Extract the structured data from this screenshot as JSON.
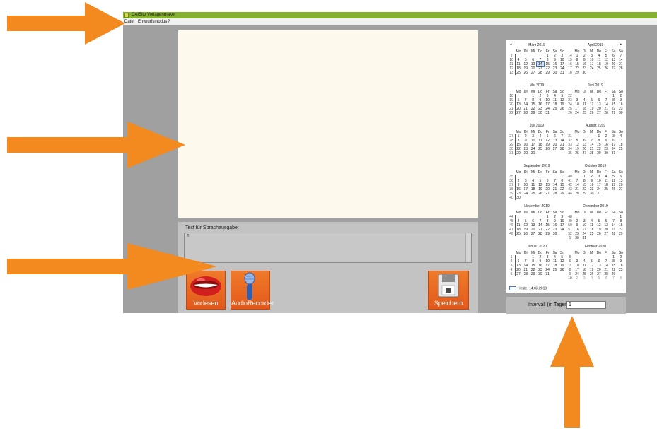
{
  "window": {
    "title": "CAIBito Vorlagenmaker",
    "menu": [
      "Datei",
      "Entwurfsmodus",
      "?"
    ]
  },
  "tts": {
    "label": "Text für Sprachausgabe:",
    "value": "1"
  },
  "buttons": {
    "vorlesen": "Vorlesen",
    "audio_recorder": "AudioRecorder",
    "speichern": "Speichern"
  },
  "calendar": {
    "weekday_headers": [
      "Mo",
      "Di",
      "Mi",
      "Do",
      "Fr",
      "Sa",
      "So"
    ],
    "today_label": "Heute: 14.03.2019",
    "selected_day": "14",
    "months": [
      {
        "title": "März 2019",
        "weeks": [
          [
            "9",
            "",
            "",
            "",
            "",
            "1",
            "2",
            "3"
          ],
          [
            "10",
            "4",
            "5",
            "6",
            "7",
            "8",
            "9",
            "10"
          ],
          [
            "11",
            "11",
            "12",
            "13",
            "14",
            "15",
            "16",
            "17"
          ],
          [
            "12",
            "18",
            "19",
            "20",
            "21",
            "22",
            "23",
            "24"
          ],
          [
            "13",
            "25",
            "26",
            "27",
            "28",
            "29",
            "30",
            "31"
          ]
        ]
      },
      {
        "title": "April 2019",
        "weeks": [
          [
            "14",
            "1",
            "2",
            "3",
            "4",
            "5",
            "6",
            "7"
          ],
          [
            "15",
            "8",
            "9",
            "10",
            "11",
            "12",
            "13",
            "14"
          ],
          [
            "16",
            "15",
            "16",
            "17",
            "18",
            "19",
            "20",
            "21"
          ],
          [
            "17",
            "22",
            "23",
            "24",
            "25",
            "26",
            "27",
            "28"
          ],
          [
            "18",
            "29",
            "30",
            "",
            "",
            "",
            "",
            ""
          ]
        ]
      },
      {
        "title": "Mai 2019",
        "weeks": [
          [
            "18",
            "",
            "",
            "1",
            "2",
            "3",
            "4",
            "5"
          ],
          [
            "19",
            "6",
            "7",
            "8",
            "9",
            "10",
            "11",
            "12"
          ],
          [
            "20",
            "13",
            "14",
            "15",
            "16",
            "17",
            "18",
            "19"
          ],
          [
            "21",
            "20",
            "21",
            "22",
            "23",
            "24",
            "25",
            "26"
          ],
          [
            "22",
            "27",
            "28",
            "29",
            "30",
            "31",
            "",
            ""
          ]
        ]
      },
      {
        "title": "Juni 2019",
        "weeks": [
          [
            "22",
            "",
            "",
            "",
            "",
            "",
            "1",
            "2"
          ],
          [
            "23",
            "3",
            "4",
            "5",
            "6",
            "7",
            "8",
            "9"
          ],
          [
            "24",
            "10",
            "11",
            "12",
            "13",
            "14",
            "15",
            "16"
          ],
          [
            "25",
            "17",
            "18",
            "19",
            "20",
            "21",
            "22",
            "23"
          ],
          [
            "26",
            "24",
            "25",
            "26",
            "27",
            "28",
            "29",
            "30"
          ]
        ]
      },
      {
        "title": "Juli 2019",
        "weeks": [
          [
            "27",
            "1",
            "2",
            "3",
            "4",
            "5",
            "6",
            "7"
          ],
          [
            "28",
            "8",
            "9",
            "10",
            "11",
            "12",
            "13",
            "14"
          ],
          [
            "29",
            "15",
            "16",
            "17",
            "18",
            "19",
            "20",
            "21"
          ],
          [
            "30",
            "22",
            "23",
            "24",
            "25",
            "26",
            "27",
            "28"
          ],
          [
            "31",
            "29",
            "30",
            "31",
            "",
            "",
            "",
            ""
          ]
        ]
      },
      {
        "title": "August 2019",
        "weeks": [
          [
            "31",
            "",
            "",
            "",
            "1",
            "2",
            "3",
            "4"
          ],
          [
            "32",
            "5",
            "6",
            "7",
            "8",
            "9",
            "10",
            "11"
          ],
          [
            "33",
            "12",
            "13",
            "14",
            "15",
            "16",
            "17",
            "18"
          ],
          [
            "34",
            "19",
            "20",
            "21",
            "22",
            "23",
            "24",
            "25"
          ],
          [
            "35",
            "26",
            "27",
            "28",
            "29",
            "30",
            "31",
            ""
          ]
        ]
      },
      {
        "title": "September 2019",
        "weeks": [
          [
            "35",
            "",
            "",
            "",
            "",
            "",
            "",
            "1"
          ],
          [
            "36",
            "2",
            "3",
            "4",
            "5",
            "6",
            "7",
            "8"
          ],
          [
            "37",
            "9",
            "10",
            "11",
            "12",
            "13",
            "14",
            "15"
          ],
          [
            "38",
            "16",
            "17",
            "18",
            "19",
            "20",
            "21",
            "22"
          ],
          [
            "39",
            "23",
            "24",
            "25",
            "26",
            "27",
            "28",
            "29"
          ],
          [
            "40",
            "30",
            "",
            "",
            "",
            "",
            "",
            ""
          ]
        ]
      },
      {
        "title": "Oktober 2019",
        "weeks": [
          [
            "40",
            "",
            "1",
            "2",
            "3",
            "4",
            "5",
            "6"
          ],
          [
            "41",
            "7",
            "8",
            "9",
            "10",
            "11",
            "12",
            "13"
          ],
          [
            "42",
            "14",
            "15",
            "16",
            "17",
            "18",
            "19",
            "20"
          ],
          [
            "43",
            "21",
            "22",
            "23",
            "24",
            "25",
            "26",
            "27"
          ],
          [
            "44",
            "28",
            "29",
            "30",
            "31",
            "",
            "",
            ""
          ]
        ]
      },
      {
        "title": "November 2019",
        "weeks": [
          [
            "44",
            "",
            "",
            "",
            "",
            "1",
            "2",
            "3"
          ],
          [
            "45",
            "4",
            "5",
            "6",
            "7",
            "8",
            "9",
            "10"
          ],
          [
            "46",
            "11",
            "12",
            "13",
            "14",
            "15",
            "16",
            "17"
          ],
          [
            "47",
            "18",
            "19",
            "20",
            "21",
            "22",
            "23",
            "24"
          ],
          [
            "48",
            "25",
            "26",
            "27",
            "28",
            "29",
            "30",
            ""
          ]
        ]
      },
      {
        "title": "Dezember 2019",
        "weeks": [
          [
            "48",
            "",
            "",
            "",
            "",
            "",
            "",
            "1"
          ],
          [
            "49",
            "2",
            "3",
            "4",
            "5",
            "6",
            "7",
            "8"
          ],
          [
            "50",
            "9",
            "10",
            "11",
            "12",
            "13",
            "14",
            "15"
          ],
          [
            "51",
            "16",
            "17",
            "18",
            "19",
            "20",
            "21",
            "22"
          ],
          [
            "52",
            "23",
            "24",
            "25",
            "26",
            "27",
            "28",
            "29"
          ],
          [
            "1",
            "30",
            "31",
            "",
            "",
            "",
            "",
            ""
          ]
        ]
      },
      {
        "title": "Januar 2020",
        "weeks": [
          [
            "1",
            "",
            "",
            "1",
            "2",
            "3",
            "4",
            "5"
          ],
          [
            "2",
            "6",
            "7",
            "8",
            "9",
            "10",
            "11",
            "12"
          ],
          [
            "3",
            "13",
            "14",
            "15",
            "16",
            "17",
            "18",
            "19"
          ],
          [
            "4",
            "20",
            "21",
            "22",
            "23",
            "24",
            "25",
            "26"
          ],
          [
            "5",
            "27",
            "28",
            "29",
            "30",
            "31",
            "",
            ""
          ]
        ]
      },
      {
        "title": "Februar 2020",
        "weeks": [
          [
            "5",
            "",
            "",
            "",
            "",
            "",
            "1",
            "2"
          ],
          [
            "6",
            "3",
            "4",
            "5",
            "6",
            "7",
            "8",
            "9"
          ],
          [
            "7",
            "10",
            "11",
            "12",
            "13",
            "14",
            "15",
            "16"
          ],
          [
            "8",
            "17",
            "18",
            "19",
            "20",
            "21",
            "22",
            "23"
          ],
          [
            "9",
            "24",
            "25",
            "26",
            "27",
            "28",
            "29",
            ""
          ],
          [
            "10",
            "2",
            "3",
            "4",
            "5",
            "6",
            "7",
            "8"
          ]
        ]
      }
    ]
  },
  "interval": {
    "label": "Intervall (in Tagen):",
    "value": "1"
  },
  "colors": {
    "arrow": "#f28a1f",
    "titlebar": "#86b032",
    "orange_button": "#e8621f"
  },
  "icons": [
    "lips-icon",
    "microphone-icon",
    "floppy-disk-icon",
    "arrow-right-icon",
    "arrow-up-icon"
  ]
}
